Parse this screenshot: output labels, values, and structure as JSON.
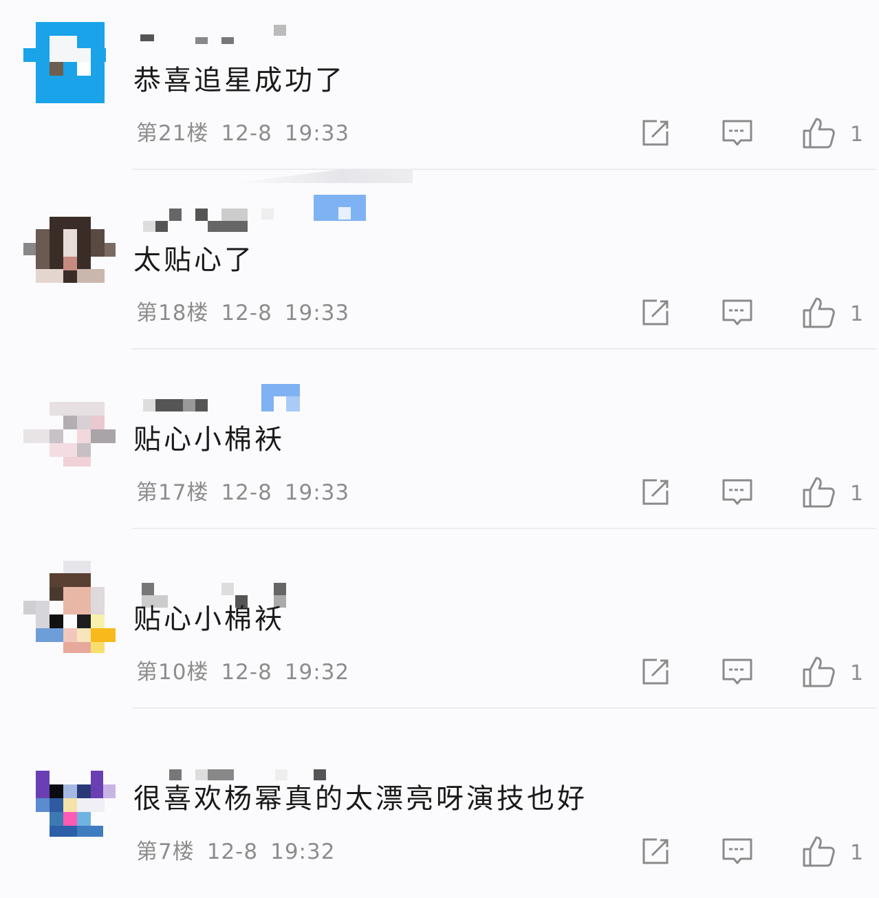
{
  "icons": {
    "edit": "share-edit-icon",
    "reply": "comment-bubble-icon",
    "like": "thumbs-up-icon"
  },
  "comments": [
    {
      "text": "恭喜追星成功了",
      "floor": "第21楼",
      "date": "12-8",
      "time": "19:33",
      "likes": "1"
    },
    {
      "text": "太贴心了",
      "floor": "第18楼",
      "date": "12-8",
      "time": "19:33",
      "likes": "1"
    },
    {
      "text": "贴心小棉袄",
      "floor": "第17楼",
      "date": "12-8",
      "time": "19:33",
      "likes": "1"
    },
    {
      "text": "贴心小棉袄",
      "floor": "第10楼",
      "date": "12-8",
      "time": "19:32",
      "likes": "1"
    },
    {
      "text": "很喜欢杨幂真的太漂亮呀演技也好",
      "floor": "第7楼",
      "date": "12-8",
      "time": "19:32",
      "likes": "1"
    }
  ]
}
